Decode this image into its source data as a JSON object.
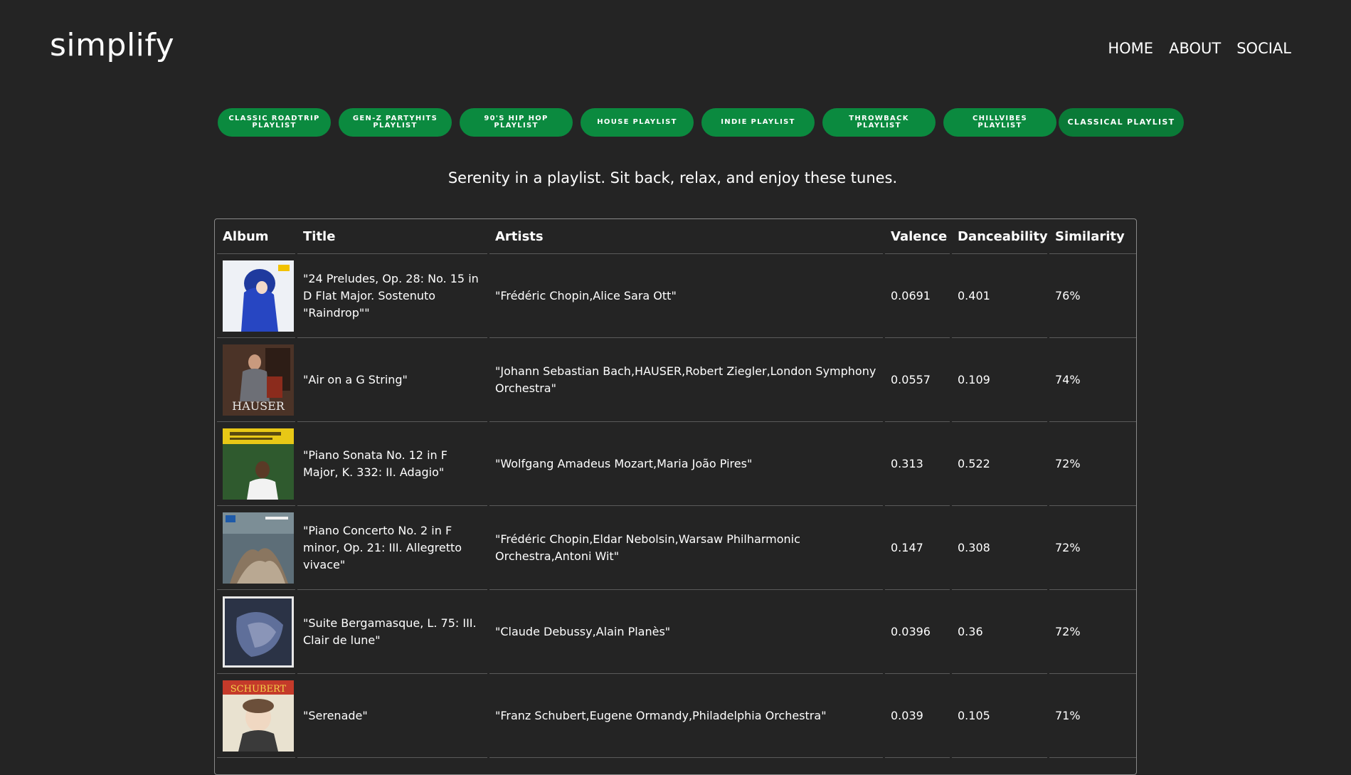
{
  "header": {
    "logo": "simplify",
    "nav": [
      {
        "label": "HOME"
      },
      {
        "label": "ABOUT"
      },
      {
        "label": "SOCIAL"
      }
    ]
  },
  "playlists": [
    {
      "label": "CLASSIC ROADTRIP PLAYLIST",
      "active": false
    },
    {
      "label": "GEN-Z PARTYHITS PLAYLIST",
      "active": false
    },
    {
      "label": "90'S HIP HOP PLAYLIST",
      "active": false
    },
    {
      "label": "HOUSE PLAYLIST",
      "active": false
    },
    {
      "label": "INDIE PLAYLIST",
      "active": false
    },
    {
      "label": "THROWBACK PLAYLIST",
      "active": false
    },
    {
      "label": "CHILLVIBES PLAYLIST",
      "active": false
    },
    {
      "label": "CLASSICAL PLAYLIST",
      "active": true
    }
  ],
  "tagline": "Serenity in a playlist. Sit back, relax, and enjoy these tunes.",
  "table": {
    "columns": [
      "Album",
      "Title",
      "Artists",
      "Valence",
      "Danceability",
      "Similarity"
    ],
    "rows": [
      {
        "album_icon": "album-cover-blue-portrait",
        "title": "\"24 Preludes, Op. 28: No. 15 in D Flat Major. Sostenuto \"Raindrop\"\"",
        "artists": "\"Frédéric Chopin,Alice Sara Ott\"",
        "valence": "0.0691",
        "danceability": "0.401",
        "similarity": "76%"
      },
      {
        "album_icon": "album-cover-hauser",
        "title": "\"Air on a G String\"",
        "artists": "\"Johann Sebastian Bach,HAUSER,Robert Ziegler,London Symphony Orchestra\"",
        "valence": "0.0557",
        "danceability": "0.109",
        "similarity": "74%"
      },
      {
        "album_icon": "album-cover-mozart-sonatas",
        "title": "\"Piano Sonata No. 12 in F Major, K. 332: II. Adagio\"",
        "artists": "\"Wolfgang Amadeus Mozart,Maria João Pires\"",
        "valence": "0.313",
        "danceability": "0.522",
        "similarity": "72%"
      },
      {
        "album_icon": "album-cover-chopin-concerto",
        "title": "\"Piano Concerto No. 2 in F minor, Op. 21: III. Allegretto vivace\"",
        "artists": "\"Frédéric Chopin,Eldar Nebolsin,Warsaw Philharmonic Orchestra,Antoni Wit\"",
        "valence": "0.147",
        "danceability": "0.308",
        "similarity": "72%"
      },
      {
        "album_icon": "album-cover-debussy",
        "title": "\"Suite Bergamasque, L. 75: III. Clair de lune\"",
        "artists": "\"Claude Debussy,Alain Planès\"",
        "valence": "0.0396",
        "danceability": "0.36",
        "similarity": "72%"
      },
      {
        "album_icon": "album-cover-schubert",
        "title": "\"Serenade\"",
        "artists": "\"Franz Schubert,Eugene Ormandy,Philadelphia Orchestra\"",
        "valence": "0.039",
        "danceability": "0.105",
        "similarity": "71%"
      }
    ]
  },
  "colors": {
    "background": "#242424",
    "pill": "#0b8a3f",
    "text": "#ffffff",
    "border": "#8a8a8a"
  }
}
